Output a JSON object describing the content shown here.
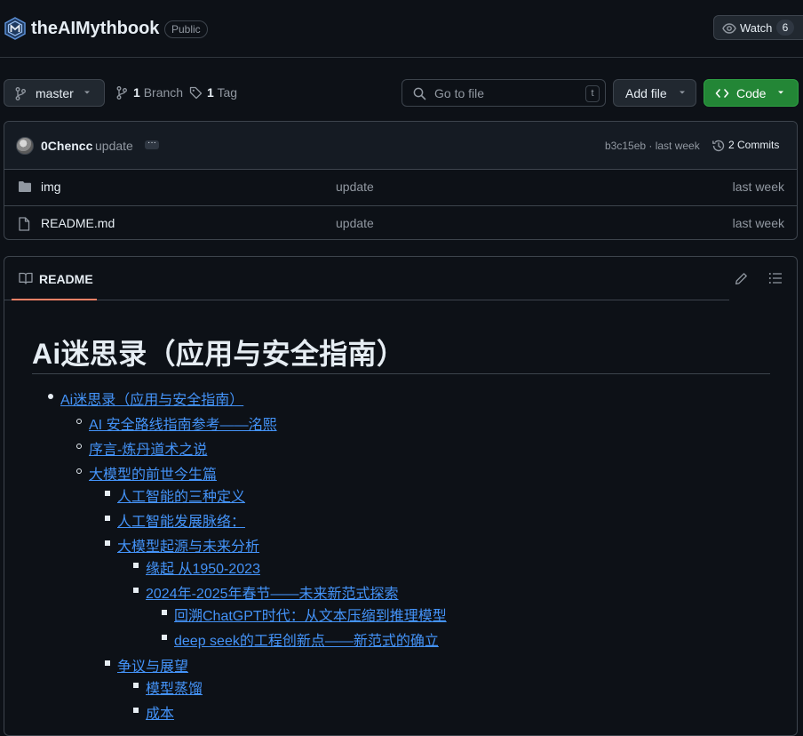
{
  "repo": {
    "name": "theAIMythbook",
    "visibility": "Public",
    "watch_label": "Watch",
    "watch_count": "6"
  },
  "toolbar": {
    "branch": "master",
    "branch_count": "1",
    "branch_label": "Branch",
    "tag_count": "1",
    "tag_label": "Tag",
    "search_placeholder": "Go to file",
    "search_shortcut": "t",
    "add_file": "Add file",
    "code": "Code"
  },
  "commit": {
    "author": "0Chencc",
    "message": "update",
    "hash_time": "b3c15eb · last week",
    "commits": "2 Commits"
  },
  "files": [
    {
      "name": "img",
      "type": "folder",
      "message": "update",
      "time": "last week"
    },
    {
      "name": "README.md",
      "type": "file",
      "message": "update",
      "time": "last week"
    }
  ],
  "readme": {
    "tab": "README",
    "title": "Ai迷思录（应用与安全指南）",
    "toc": [
      {
        "text": "Ai迷思录（应用与安全指南）",
        "level": 1
      },
      {
        "text": "AI 安全路线指南参考——洺熙",
        "level": 2
      },
      {
        "text": "序言-炼丹道术之说",
        "level": 2
      },
      {
        "text": "大模型的前世今生篇",
        "level": 2
      },
      {
        "text": "人工智能的三种定义",
        "level": 3
      },
      {
        "text": "人工智能发展脉络：",
        "level": 3
      },
      {
        "text": "大模型起源与未来分析",
        "level": 3
      },
      {
        "text": "缘起 从1950-2023",
        "level": 4
      },
      {
        "text": "2024年-2025年春节——未来新范式探索",
        "level": 4
      },
      {
        "text": "回溯ChatGPT时代：从文本压缩到推理模型",
        "level": 5
      },
      {
        "text": "deep seek的工程创新点——新范式的确立",
        "level": 5
      },
      {
        "text": "争议与展望",
        "level": 3
      },
      {
        "text": "模型蒸馏",
        "level": 4
      },
      {
        "text": "成本",
        "level": 4
      }
    ]
  },
  "colors": {
    "background": "#0d1117",
    "link": "#4493f8",
    "code_button": "#238636",
    "tab_underline": "#f78166"
  }
}
